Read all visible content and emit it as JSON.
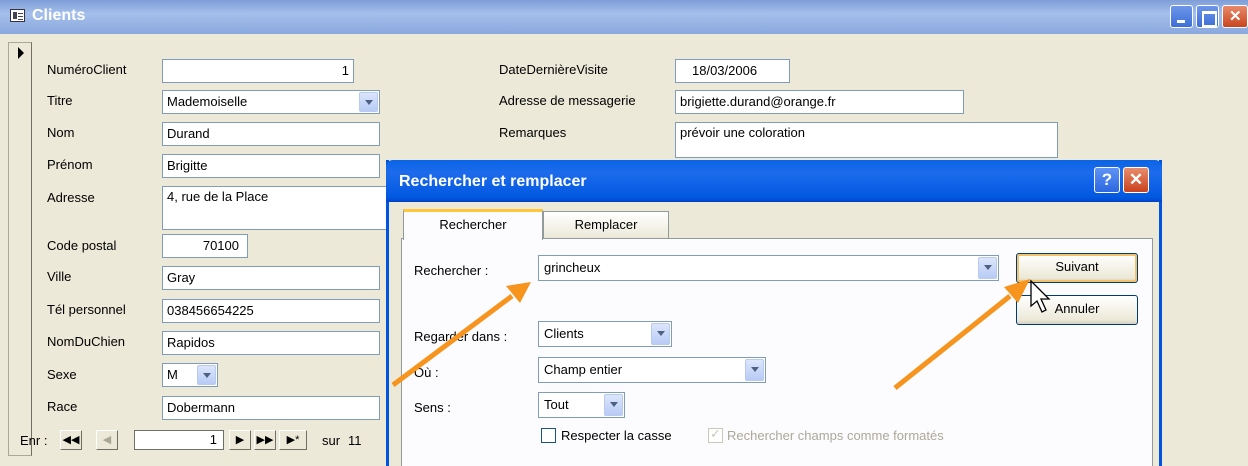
{
  "window": {
    "title": "Clients"
  },
  "form": {
    "labels": {
      "numero_client": "NuméroClient",
      "titre": "Titre",
      "nom": "Nom",
      "prenom": "Prénom",
      "adresse": "Adresse",
      "code_postal": "Code postal",
      "ville": "Ville",
      "tel": "Tél personnel",
      "chien": "NomDuChien",
      "sexe": "Sexe",
      "race": "Race",
      "date_visite": "DateDernièreVisite",
      "email": "Adresse de messagerie",
      "remarques": "Remarques"
    },
    "values": {
      "numero_client": "1",
      "titre": "Mademoiselle",
      "nom": "Durand",
      "prenom": "Brigitte",
      "adresse": "4, rue de la Place",
      "code_postal": "70100",
      "ville": "Gray",
      "tel": "038456654225",
      "chien": "Rapidos",
      "sexe": "M",
      "race": "Dobermann",
      "date_visite": "18/03/2006",
      "email": "brigiette.durand@orange.fr",
      "remarques": "prévoir une coloration"
    }
  },
  "record_nav": {
    "label": "Enr :",
    "current": "1",
    "of_label": "sur",
    "total": "11"
  },
  "dialog": {
    "title": "Rechercher et remplacer",
    "help_label": "?",
    "tabs": [
      "Rechercher",
      "Remplacer"
    ],
    "find_label": "Rechercher :",
    "find_value": "grincheux",
    "look_in_label": "Regarder dans :",
    "look_in_value": "Clients",
    "match_label": "Où :",
    "match_value": "Champ entier",
    "search_label": "Sens :",
    "search_value": "Tout",
    "match_case_label": "Respecter la casse",
    "match_case_checked": false,
    "formatted_label": "Rechercher champs comme formatés",
    "formatted_checked": true,
    "find_next_label": "Suivant",
    "cancel_label": "Annuler"
  },
  "colors": {
    "arrow": "#f7941d",
    "title_blue": "#0058e0",
    "window_bg": "#ece9d8"
  }
}
